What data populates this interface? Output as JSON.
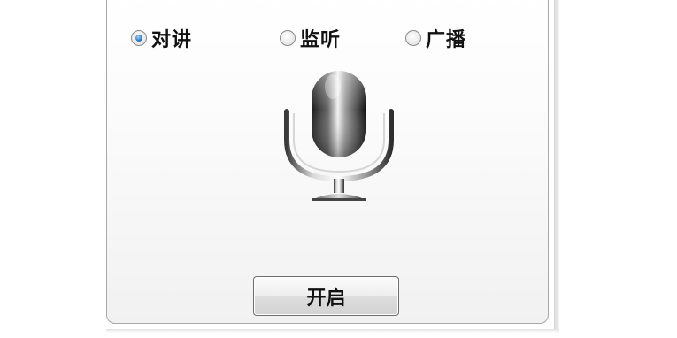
{
  "mode_options": [
    {
      "label": "对讲",
      "checked": true
    },
    {
      "label": "监听",
      "checked": false
    },
    {
      "label": "广播",
      "checked": false
    }
  ],
  "microphone": {
    "icon": "microphone-icon"
  },
  "start_button": {
    "label": "开启"
  },
  "colors": {
    "panel_border": "#a8a8a8",
    "radio_checked": "#2a78c8",
    "button_border": "#6e6e6e"
  }
}
